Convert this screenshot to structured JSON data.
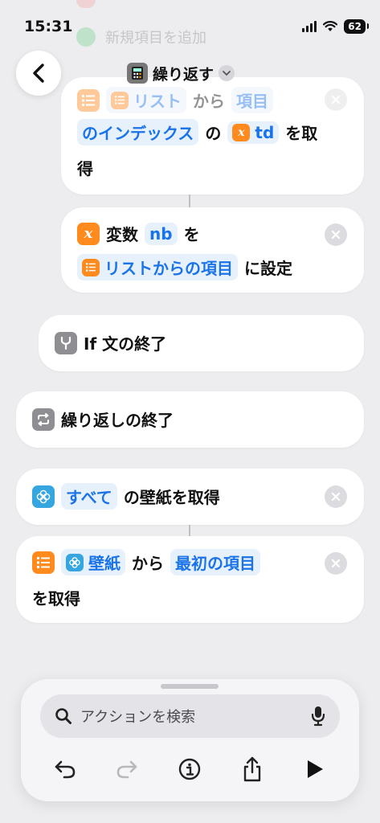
{
  "status": {
    "time": "15:31",
    "battery": "62"
  },
  "header": {
    "title": "繰り返す"
  },
  "background": {
    "ghost_label": "新規項目を追加"
  },
  "cards": {
    "get_item": {
      "token_list": "リスト",
      "text_from": "から",
      "token_item": "項目",
      "token_index": "のインデックス",
      "text_no": "の",
      "token_var": "td",
      "text_get": "を取",
      "text_get2": "得"
    },
    "set_var": {
      "text_var": "変数",
      "token_name": "nb",
      "text_wo": "を",
      "token_value": "リストからの項目",
      "text_set": "に設定"
    },
    "end_if": {
      "label": "If 文の終了"
    },
    "end_repeat": {
      "label": "繰り返しの終了"
    },
    "get_wallpaper": {
      "token_all": "すべて",
      "text": "の壁紙を取得"
    },
    "get_from": {
      "token_wallpaper": "壁紙",
      "text_from": "から",
      "token_first": "最初の項目",
      "text_get": "を取得"
    }
  },
  "toolbar": {
    "search_placeholder": "アクションを検索"
  },
  "icons": {
    "back": "chevron-left-icon",
    "list": "list-icon",
    "variable": "variable-x-icon",
    "if": "branch-icon",
    "repeat": "repeat-icon",
    "wallpaper": "flower-icon",
    "close": "close-icon",
    "search": "search-icon",
    "mic": "microphone-icon",
    "undo": "undo-icon",
    "redo": "redo-icon",
    "info": "info-icon",
    "share": "share-icon",
    "play": "play-icon"
  },
  "colors": {
    "accent": "#1a73e8",
    "token_bg": "#e7f1fc",
    "orange": "#ff8a1e",
    "gray_icon": "#8e8e93",
    "wallpaper": "#36a6e0"
  }
}
